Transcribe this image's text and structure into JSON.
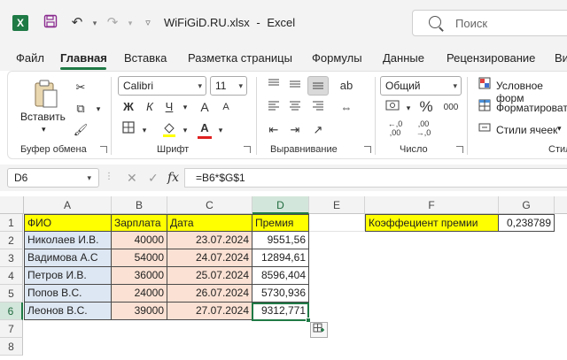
{
  "titlebar": {
    "app_letter": "X",
    "filename": "WiFiGiD.RU.xlsx",
    "separator": "-",
    "app_name": "Excel",
    "search_placeholder": "Поиск"
  },
  "menu": [
    "Файл",
    "Главная",
    "Вставка",
    "Разметка страницы",
    "Формулы",
    "Данные",
    "Рецензирование",
    "Ви"
  ],
  "ribbon": {
    "clipboard": {
      "paste_label": "Вставить",
      "group_label": "Буфер обмена"
    },
    "font": {
      "font_name": "Calibri",
      "font_size": "11",
      "bold": "Ж",
      "italic": "К",
      "underline": "Ч",
      "grow": "A",
      "shrink": "A",
      "font_color_letter": "A",
      "group_label": "Шрифт"
    },
    "alignment": {
      "group_label": "Выравнивание"
    },
    "number": {
      "format": "Общий",
      "percent": "%",
      "thousands": "000",
      "group_label": "Число",
      "inc_decimals": "←,0 ,00",
      "dec_decimals": ",00 →,0"
    },
    "styles": {
      "conditional": "Условное форм",
      "format_table": "Форматироват",
      "cell_styles": "Стили ячеек",
      "group_label": "Стил"
    }
  },
  "formula_bar": {
    "name_box": "D6",
    "fx": "fx",
    "formula": "=B6*$G$1"
  },
  "grid": {
    "columns": [
      "A",
      "B",
      "C",
      "D",
      "E",
      "F",
      "G"
    ],
    "rows": [
      "1",
      "2",
      "3",
      "4",
      "5",
      "6",
      "7",
      "8"
    ],
    "headers": [
      "ФИО",
      "Зарплата",
      "Дата",
      "Премия"
    ],
    "data": [
      [
        "Николаев И.В.",
        "40000",
        "23.07.2024",
        "9551,56"
      ],
      [
        "Вадимова А.С",
        "54000",
        "24.07.2024",
        "12894,61"
      ],
      [
        "Петров И.В.",
        "36000",
        "25.07.2024",
        "8596,404"
      ],
      [
        "Попов В.С.",
        "24000",
        "26.07.2024",
        "5730,936"
      ],
      [
        "Леонов В.С.",
        "39000",
        "27.07.2024",
        "9312,771"
      ]
    ],
    "coef_label": "Коэффециент премии",
    "coef_value": "0,238789"
  },
  "colors": {
    "excel_green": "#1f7a45",
    "yellow": "#ffff00",
    "blue_fill": "#dde7f3",
    "peach_fill": "#fbe1d3",
    "font_color_red": "#e02020"
  }
}
